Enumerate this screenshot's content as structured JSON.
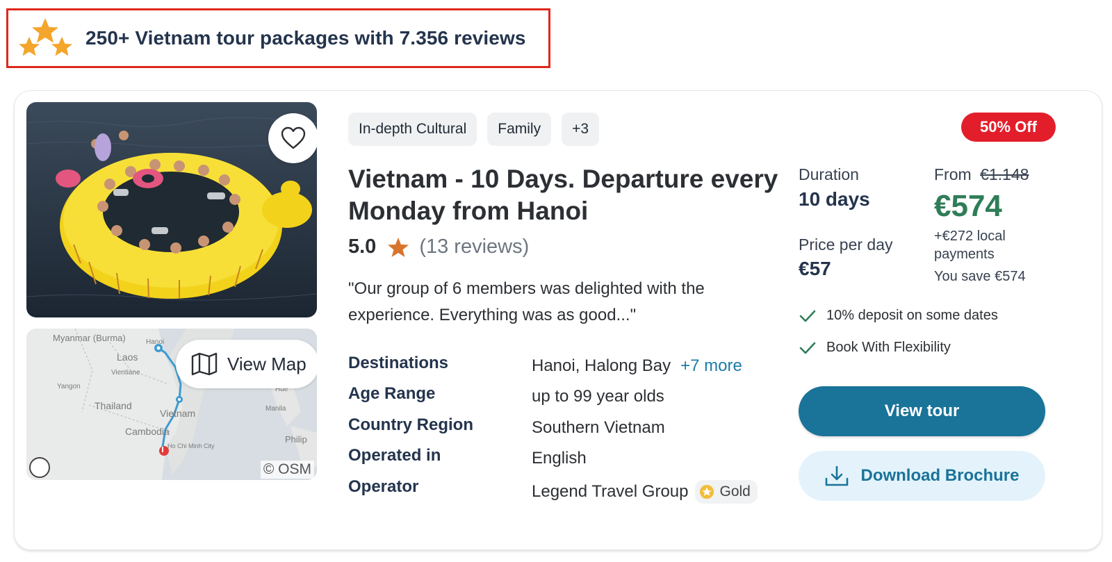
{
  "header": {
    "title": "250+ Vietnam tour packages with 7.356 reviews",
    "icon": "stars-icon",
    "star_color": "#f4a52c",
    "border_color": "#e0271c"
  },
  "card": {
    "photo": {
      "icon": "photo-raft"
    },
    "favorite": {
      "icon": "heart-icon"
    },
    "map": {
      "button_label": "View Map",
      "labels": [
        "Myanmar (Burma)",
        "Laos",
        "Vientiane",
        "Yangon",
        "Thailand",
        "Vietnam",
        "Cambodia",
        "Hanoi",
        "Hue",
        "Manila",
        "Philip",
        "Ho Chi Minh City"
      ],
      "attribution": "© OSM",
      "route_color": "#3d9bd0",
      "end_marker_color": "#e23b3b"
    },
    "tags": [
      "In-depth Cultural",
      "Family",
      "+3"
    ],
    "title": "Vietnam - 10 Days. Departure every Monday from Hanoi",
    "rating": {
      "score": "5.0",
      "reviews": "(13 reviews)",
      "star_color": "#d9742d"
    },
    "quote": "\"Our group of 6 members was delighted with the experience. Everything was as good...\"",
    "details": [
      {
        "label": "Destinations",
        "value": "Hanoi, Halong Bay",
        "more": "+7 more"
      },
      {
        "label": "Age Range",
        "value": "up to 99 year olds"
      },
      {
        "label": "Country Region",
        "value": "Southern Vietnam"
      },
      {
        "label": "Operated in",
        "value": "English"
      },
      {
        "label": "Operator",
        "value": "Legend Travel Group",
        "badge": "Gold"
      }
    ],
    "discount_badge": "50% Off",
    "duration": {
      "label": "Duration",
      "value": "10 days"
    },
    "price_per_day": {
      "label": "Price per day",
      "value": "€57"
    },
    "price": {
      "from_label": "From",
      "old_price": "€1.148",
      "current": "€574",
      "local_payments": "+€272 local payments",
      "savings": "You save €574",
      "color": "#2f7d58"
    },
    "features": [
      "10% deposit on some dates",
      "Book With Flexibility"
    ],
    "buttons": {
      "view_tour": "View tour",
      "download": "Download Brochure",
      "primary_color": "#1a7399"
    }
  }
}
